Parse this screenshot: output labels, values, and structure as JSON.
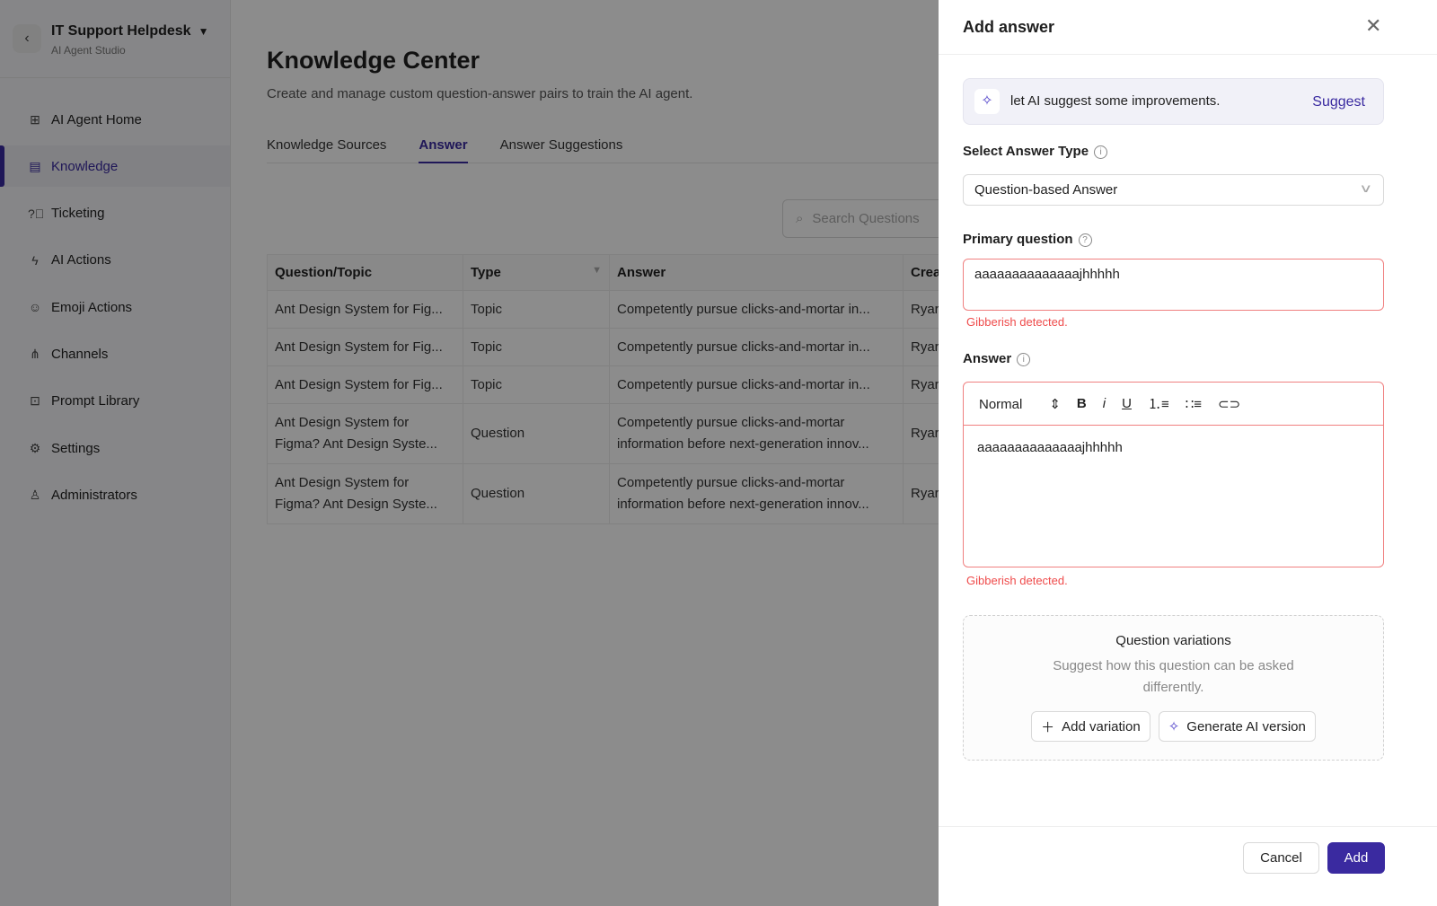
{
  "sidebar": {
    "app_title": "IT Support Helpdesk",
    "app_subtitle": "AI Agent Studio",
    "items": [
      {
        "label": "AI Agent Home",
        "icon": "grid-icon"
      },
      {
        "label": "Knowledge",
        "icon": "book-icon",
        "active": true
      },
      {
        "label": "Ticketing",
        "icon": "question-circle-icon"
      },
      {
        "label": "AI Actions",
        "icon": "lightning-icon"
      },
      {
        "label": "Emoji Actions",
        "icon": "smile-icon"
      },
      {
        "label": "Channels",
        "icon": "network-icon"
      },
      {
        "label": "Prompt Library",
        "icon": "terminal-icon"
      },
      {
        "label": "Settings",
        "icon": "gear-icon"
      },
      {
        "label": "Administrators",
        "icon": "user-admin-icon"
      }
    ]
  },
  "main": {
    "title": "Knowledge Center",
    "subtitle": "Create and manage custom question-answer pairs to train the AI agent.",
    "tabs": [
      "Knowledge Sources",
      "Answer",
      "Answer Suggestions"
    ],
    "active_tab": "Answer",
    "search_placeholder": "Search Questions",
    "columns": [
      "Question/Topic",
      "Type",
      "Answer",
      "Crea"
    ],
    "rows": [
      [
        "Ant Design System for Fig...",
        "Topic",
        "Competently pursue clicks-and-mortar in...",
        "Ryar"
      ],
      [
        "Ant Design System for Fig...",
        "Topic",
        "Competently pursue clicks-and-mortar in...",
        "Ryar"
      ],
      [
        "Ant Design System for Fig...",
        "Topic",
        "Competently pursue clicks-and-mortar in...",
        "Ryar"
      ],
      [
        "Ant Design System for\nFigma? Ant Design Syste...",
        "Question",
        "Competently pursue clicks-and-mortar\ninformation before next-generation innov...",
        "Ryar"
      ],
      [
        "Ant Design System for\nFigma? Ant Design Syste...",
        "Question",
        "Competently pursue clicks-and-mortar\ninformation before next-generation innov...",
        "Ryar"
      ]
    ]
  },
  "drawer": {
    "title": "Add answer",
    "suggest_text": "let AI suggest some improvements.",
    "suggest_link": "Suggest",
    "answer_type_label": "Select Answer Type",
    "answer_type_value": "Question-based Answer",
    "primary_question_label": "Primary question",
    "primary_question_value": "aaaaaaaaaaaaaajhhhhh",
    "primary_error": "Gibberish detected.",
    "answer_label": "Answer",
    "format_value": "Normal",
    "answer_value": "aaaaaaaaaaaaaajhhhhh",
    "answer_error": "Gibberish detected.",
    "variations_title": "Question variations",
    "variations_desc": "Suggest how this question can be asked differently.",
    "add_variation": "Add variation",
    "generate_ai": "Generate AI version",
    "cancel": "Cancel",
    "add": "Add"
  },
  "colors": {
    "accent": "#3a2aa0",
    "error": "#ef4b4b"
  }
}
